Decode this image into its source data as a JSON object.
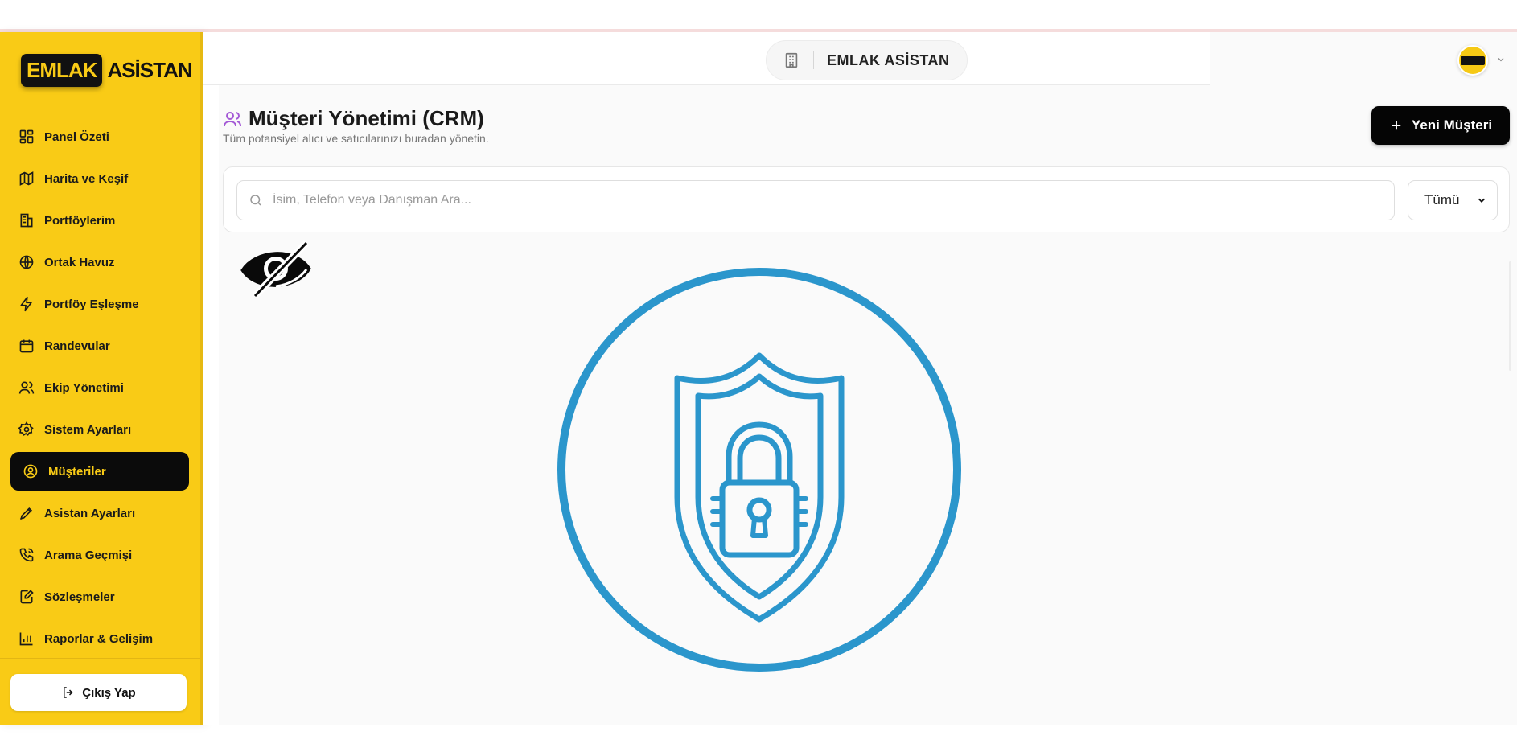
{
  "app": {
    "logo_box": "EMLAK",
    "logo_text": "ASİSTAN",
    "header_title": "EMLAK ASİSTAN"
  },
  "sidebar": {
    "items": [
      {
        "label": "Panel Özeti",
        "icon": "dashboard-icon"
      },
      {
        "label": "Harita ve Keşif",
        "icon": "map-icon"
      },
      {
        "label": "Portföylerim",
        "icon": "building-icon"
      },
      {
        "label": "Ortak Havuz",
        "icon": "globe-icon"
      },
      {
        "label": "Portföy Eşleşme",
        "icon": "lightning-icon"
      },
      {
        "label": "Randevular",
        "icon": "calendar-icon"
      },
      {
        "label": "Ekip Yönetimi",
        "icon": "users-icon"
      },
      {
        "label": "Sistem Ayarları",
        "icon": "gear-icon"
      },
      {
        "label": "Müşteriler",
        "icon": "user-circle-icon",
        "active": true
      },
      {
        "label": "Asistan Ayarları",
        "icon": "pen-icon"
      },
      {
        "label": "Arama Geçmişi",
        "icon": "phone-icon"
      },
      {
        "label": "Sözleşmeler",
        "icon": "contract-icon"
      },
      {
        "label": "Raporlar & Gelişim",
        "icon": "chart-icon"
      }
    ],
    "logout_label": "Çıkış Yap"
  },
  "page": {
    "title": "Müşteri Yönetimi (CRM)",
    "subtitle": "Tüm potansiyel alıcı ve satıcılarınızı buradan yönetin.",
    "new_button": "Yeni Müşteri"
  },
  "search": {
    "placeholder": "İsim, Telefon veya Danışman Ara...",
    "value": "",
    "filter_selected": "Tümü"
  },
  "colors": {
    "sidebar_bg": "#f9cb16",
    "active_bg": "#0b0b0b",
    "active_text": "#f9cb16",
    "shield_blue": "#2b96cc",
    "title_icon": "#a45ad6"
  }
}
